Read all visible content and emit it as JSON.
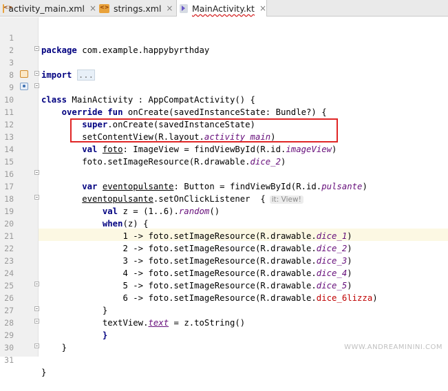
{
  "tabs": [
    {
      "label": "activity_main.xml",
      "icon": "xml-file-icon",
      "active": false
    },
    {
      "label": "strings.xml",
      "icon": "xml-file-icon",
      "active": false
    },
    {
      "label": "MainActivity.kt",
      "icon": "kotlin-file-icon",
      "active": true
    }
  ],
  "close_glyph": "×",
  "lines": [
    {
      "n": "1"
    },
    {
      "n": "2"
    },
    {
      "n": "3"
    },
    {
      "n": "8"
    },
    {
      "n": "9"
    },
    {
      "n": "10"
    },
    {
      "n": "11"
    },
    {
      "n": "12"
    },
    {
      "n": "13"
    },
    {
      "n": "14"
    },
    {
      "n": "15"
    },
    {
      "n": "16"
    },
    {
      "n": "17"
    },
    {
      "n": "18"
    },
    {
      "n": "19"
    },
    {
      "n": "20"
    },
    {
      "n": "21"
    },
    {
      "n": "22"
    },
    {
      "n": "23"
    },
    {
      "n": "24"
    },
    {
      "n": "25"
    },
    {
      "n": "26"
    },
    {
      "n": "27"
    },
    {
      "n": "28"
    },
    {
      "n": "29"
    },
    {
      "n": "30"
    },
    {
      "n": "31"
    }
  ],
  "code": {
    "l1_kw": "package",
    "l1_rest": " com.example.happybyrthday",
    "l3_kw": "import",
    "l3_dots": "...",
    "l9_kw": "class",
    "l9_rest": " MainActivity : AppCompatActivity() {",
    "l10_kw1": "override",
    "l10_kw2": "fun",
    "l10_rest": " onCreate(savedInstanceState: Bundle?) {",
    "l11_kw": "super",
    "l11_rest": ".onCreate(savedInstanceState)",
    "l12_a": "setContentView(R.layout.",
    "l12_it": "activity_main",
    "l12_b": ")",
    "l13_kw": "val",
    "l13_var": "foto",
    "l13_a": ": ImageView = findViewById(R.id.",
    "l13_it": "imageView",
    "l13_b": ")",
    "l14_a": "foto.setImageResource(R.drawable.",
    "l14_it": "dice_2",
    "l14_b": ")",
    "l16_kw": "var",
    "l16_var": "eventopulsante",
    "l16_a": ": Button = findViewById(R.id.",
    "l16_it": "pulsante",
    "l16_b": ")",
    "l17_var": "eventopulsante",
    "l17_a": ".setOnClickListener  {",
    "l17_hint": "it: View!",
    "l18_kw": "val",
    "l18_a": " z = (1..6).",
    "l18_it": "random",
    "l18_b": "()",
    "l19_kw": "when",
    "l19_a": "(z) {",
    "l20_a": "1 -> foto.setImageResource(R.drawable.",
    "l20_it": "dice_1",
    "l20_b": ")",
    "l21_a": "2 -> foto.setImageResource(R.drawable.",
    "l21_it": "dice_2",
    "l21_b": ")",
    "l22_a": "3 -> foto.setImageResource(R.drawable.",
    "l22_it": "dice_3",
    "l22_b": ")",
    "l23_a": "4 -> foto.setImageResource(R.drawable.",
    "l23_it": "dice_4",
    "l23_b": ")",
    "l24_a": "5 -> foto.setImageResource(R.drawable.",
    "l24_it": "dice_5",
    "l24_b": ")",
    "l25_a": "6 -> foto.setImageResource(R.drawable.",
    "l25_it": "dice_6lizza",
    "l25_b": ")",
    "l26": "}",
    "l27_a": "textView.",
    "l27_it": "text",
    "l27_b": " = z.toString()",
    "l28": "}",
    "l29": "}",
    "l31": "}"
  },
  "watermark": "WWW.ANDREAMININI.COM",
  "colors": {
    "keyword": "#000080",
    "italic_ref": "#660e7a",
    "error_red": "#c00000",
    "highlight_box": "#e02424",
    "current_line": "#fcf8e3"
  }
}
